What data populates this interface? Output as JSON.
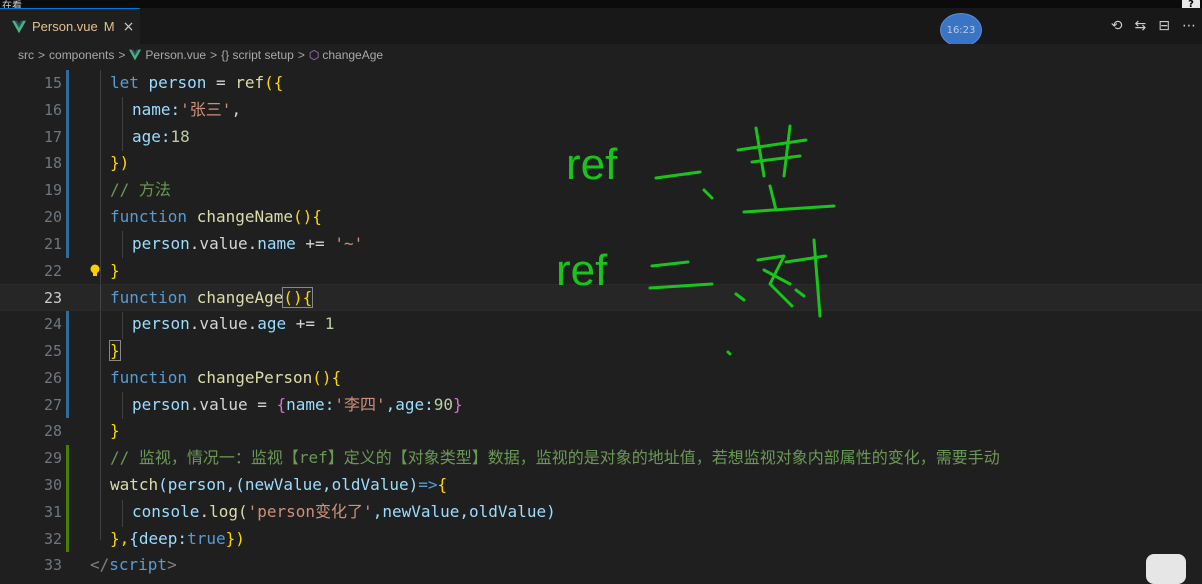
{
  "top": {
    "left_text": "在看",
    "help": "?"
  },
  "tab": {
    "file": "Person.vue",
    "status": "M",
    "close": "×",
    "icon": "vue-logo-icon"
  },
  "clock": {
    "time": "16:23"
  },
  "actions": [
    {
      "name": "timeline-icon",
      "glyph": "⟲"
    },
    {
      "name": "compare-changes-icon",
      "glyph": "⇆"
    },
    {
      "name": "split-editor-icon",
      "glyph": "⊟"
    },
    {
      "name": "more-actions-icon",
      "glyph": "⋯"
    }
  ],
  "breadcrumb": {
    "src": "src",
    "components": "components",
    "file": "Person.vue",
    "script": "{} script setup",
    "func": "changeAge",
    "sep": ">"
  },
  "lines": [
    15,
    16,
    17,
    18,
    19,
    20,
    21,
    22,
    23,
    24,
    25,
    26,
    27,
    28,
    29,
    30,
    31,
    32,
    33
  ],
  "code": {
    "l15": [
      "let",
      "person",
      "=",
      "ref",
      "({"
    ],
    "l16": [
      "name:",
      "'张三'",
      ","
    ],
    "l17": [
      "age:",
      "18"
    ],
    "l18": [
      "})"
    ],
    "l19": "// 方法",
    "l20": [
      "function",
      "changeName",
      "(){"
    ],
    "l21": [
      "person",
      ".value.",
      "name",
      "+=",
      "'~'"
    ],
    "l22": "}",
    "l23": [
      "function",
      "changeAge",
      "(){"
    ],
    "l24": [
      "person",
      ".value.",
      "age",
      "+=",
      "1"
    ],
    "l25": "}",
    "l26": [
      "function",
      "changePerson",
      "(){"
    ],
    "l27": [
      "person",
      ".value",
      "=",
      "{",
      "name:",
      "'李四'",
      ",age:",
      "90",
      "}"
    ],
    "l28": "}",
    "l29": "// 监视，情况一：监视【ref】定义的【对象类型】数据，监视的是对象的地址值，若想监视对象内部属性的变化，需要手动",
    "l30": [
      "watch",
      "(person,",
      "(newValue,oldValue)",
      "=>",
      "{"
    ],
    "l31": [
      "console",
      ".log(",
      "'person变化了'",
      ",newValue,oldValue)"
    ],
    "l32": [
      "},",
      "{deep:",
      "true",
      "})"
    ],
    "l33": [
      "</",
      "script",
      ">"
    ]
  },
  "annotations": {
    "line1_text": "ref",
    "line1_hand": "一、基",
    "line2_text": "ref",
    "line2_hand": "二、对"
  }
}
